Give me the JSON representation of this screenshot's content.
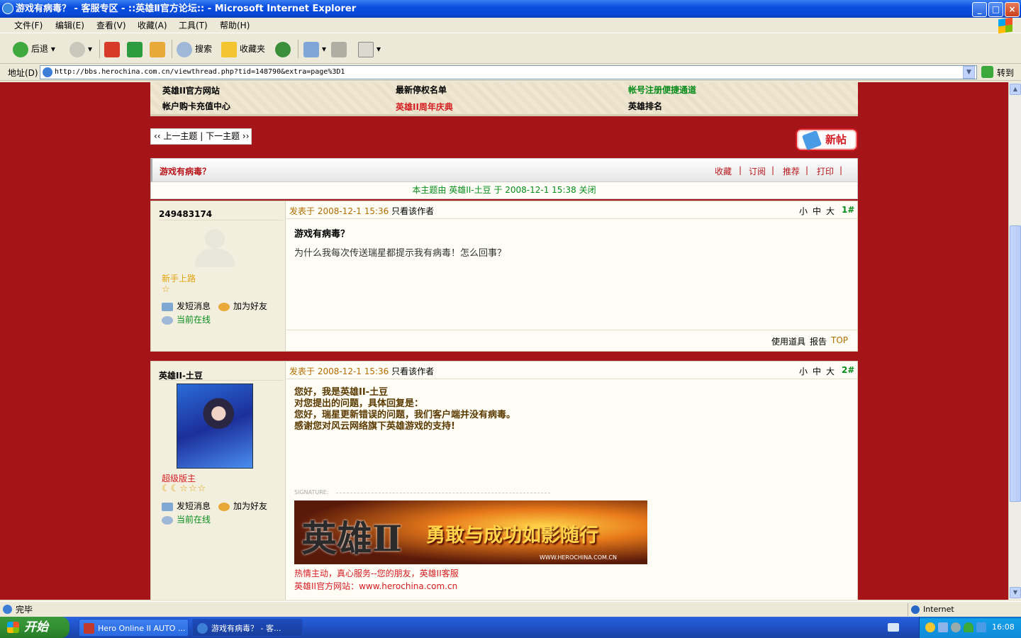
{
  "window": {
    "title": "游戏有病毒？ - 客服专区 - ::英雄Ⅱ官方论坛:: - Microsoft Internet Explorer",
    "buttons": {
      "minimize": "_",
      "maximize": "□",
      "close": "×"
    }
  },
  "menu": [
    "文件(F)",
    "编辑(E)",
    "查看(V)",
    "收藏(A)",
    "工具(T)",
    "帮助(H)"
  ],
  "toolbar": {
    "back": "后退",
    "search": "搜索",
    "favorites": "收藏夹"
  },
  "address": {
    "label": "地址(D)",
    "url": "http://bbs.herochina.com.cn/viewthread.php?tid=148790&extra=page%3D1",
    "go": "转到"
  },
  "forum": {
    "links": [
      {
        "text": "英雄II官方网站",
        "color": "#000000"
      },
      {
        "text": "最新停权名单",
        "color": "#000000"
      },
      {
        "text": "帐号注册便捷通道",
        "color": "#078c1b"
      },
      {
        "text": "帐户购卡充值中心",
        "color": "#000000"
      },
      {
        "text": "英雄II周年庆典",
        "color": "#d51c22"
      },
      {
        "text": "英雄排名",
        "color": "#000000"
      }
    ],
    "thread_nav": "‹‹ 上一主题 | 下一主题 ››",
    "new_post": "新帖",
    "thread_title": "游戏有病毒？",
    "thread_actions": [
      "收藏",
      "订阅",
      "推荐",
      "打印"
    ],
    "closed_notice": "本主题由 英雄II-土豆 于 2008-12-1 15:38 关闭",
    "font_sizes": [
      "小",
      "中",
      "大"
    ],
    "posts": [
      {
        "author": "249483174",
        "rank": "新手上路",
        "rank_color": "#e2a30c",
        "stars": "☆",
        "send_pm": "发短消息",
        "add_friend": "加为好友",
        "online": "当前在线",
        "meta": "发表于 2008-12-1 15:36",
        "only_author": "只看该作者",
        "floor": "1#",
        "subject": "游戏有病毒？",
        "body": "为什么我每次传送瑞星都提示我有病毒！怎么回事？",
        "footer": [
          "使用道具",
          "报告",
          "TOP"
        ]
      },
      {
        "author": "英雄II-土豆",
        "rank": "超级版主",
        "rank_color": "#d51c22",
        "stars": "☾☾☆☆☆",
        "send_pm": "发短消息",
        "add_friend": "加为好友",
        "online": "当前在线",
        "meta": "发表于 2008-12-1 15:36",
        "only_author": "只看该作者",
        "floor": "2#",
        "body_lines": [
          "您好，我是英雄II-土豆",
          "对您提出的问题，具体回复是：",
          "您好，瑞星更新错误的问题，我们客户端并没有病毒。",
          "感谢您对风云网络旗下英雄游戏的支持!"
        ],
        "signature_label": "SIGNATURE:",
        "banner_text": "勇敢与成功如影随行",
        "banner_logo": "英雄Ⅱ",
        "banner_url": "WWW.HEROCHINA.COM.CN",
        "sig_line1": "热情主动，真心服务--您的朋友，英雄II客服",
        "sig_line2": "英雄II官方网站：www.herochina.com.cn"
      }
    ]
  },
  "status": {
    "text": "完毕",
    "zone": "Internet"
  },
  "taskbar": {
    "start": "开始",
    "tasks": [
      "Hero Online II AUTO ...",
      "游戏有病毒？ - 客..."
    ],
    "clock": "16:08"
  },
  "colors": {
    "page_bg": "#a51419",
    "accent_red": "#b8151b",
    "green": "#078c1b",
    "orange_meta": "#b36d00"
  }
}
